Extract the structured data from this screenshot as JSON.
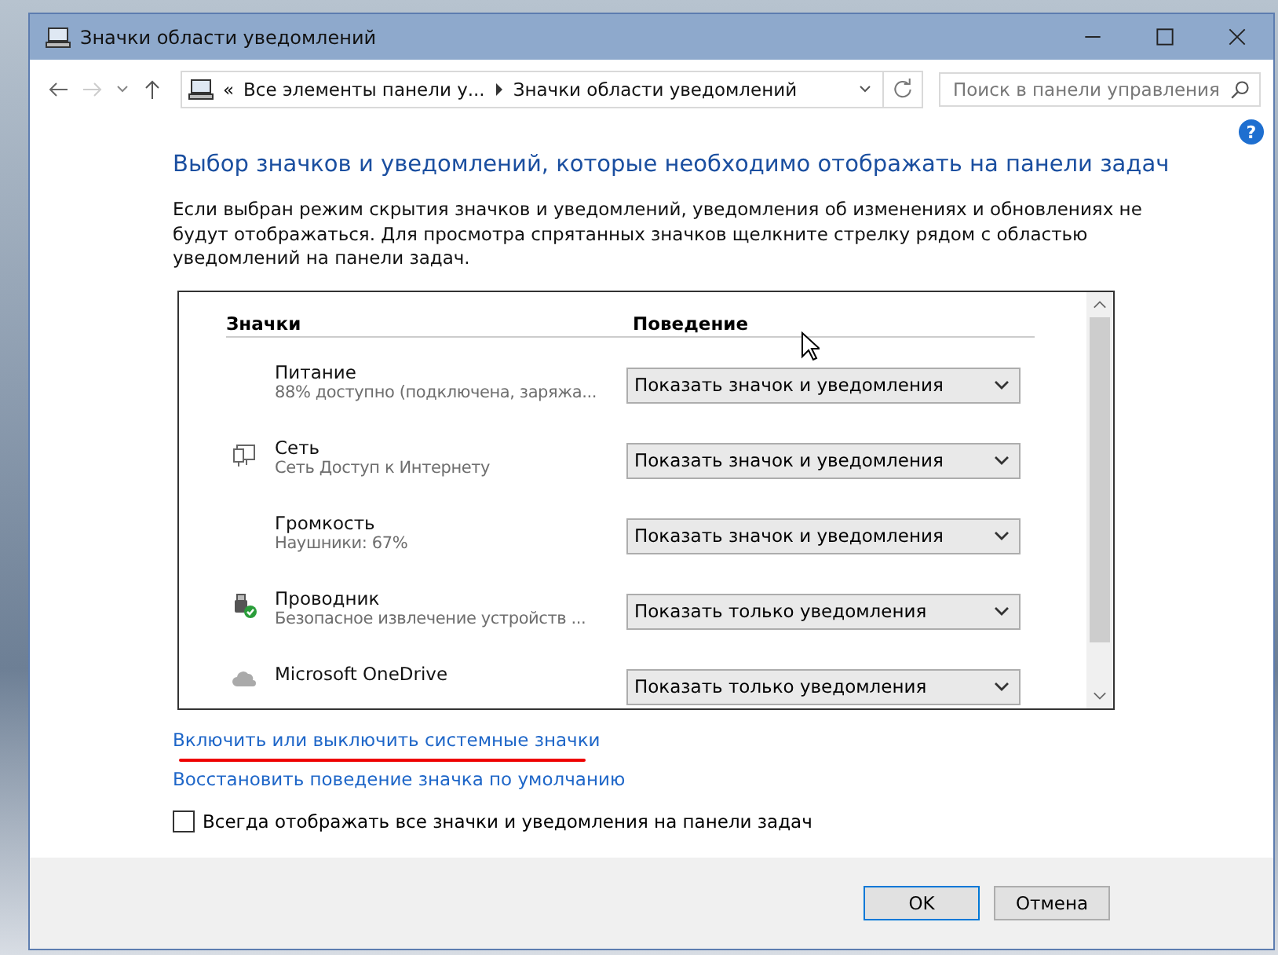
{
  "window": {
    "title": "Значки области уведомлений"
  },
  "address_bar": {
    "overflow": "«",
    "crumbs": [
      "Все элементы панели у...",
      "Значки области уведомлений"
    ]
  },
  "search": {
    "placeholder": "Поиск в панели управления"
  },
  "help": "?",
  "heading": "Выбор значков и уведомлений, которые необходимо отображать на панели задач",
  "description": "Если выбран режим скрытия значков и уведомлений, уведомления об изменениях и обновлениях не будут отображаться. Для просмотра спрятанных значков щелкните стрелку рядом с областью уведомлений на панели задач.",
  "table": {
    "columns": [
      "Значки",
      "Поведение"
    ],
    "rows": [
      {
        "kind": "plain",
        "name": "Питание",
        "detail": "88% доступно (подключена, заряжа...",
        "behavior": "Показать значок и уведомления"
      },
      {
        "kind": "network",
        "name": "Сеть",
        "detail": "Сеть Доступ к Интернету",
        "behavior": "Показать значок и уведомления"
      },
      {
        "kind": "plain",
        "name": "Громкость",
        "detail": "Наушники: 67%",
        "behavior": "Показать значок и уведомления"
      },
      {
        "kind": "drive",
        "name": "Проводник",
        "detail": "Безопасное извлечение устройств ...",
        "behavior": "Показать только уведомления"
      },
      {
        "kind": "cloud",
        "name": "Microsoft OneDrive",
        "behavior": "Показать только уведомления"
      }
    ]
  },
  "links": [
    "Включить или выключить системные значки",
    "Восстановить поведение значка по умолчанию"
  ],
  "always_show": {
    "label": "Всегда отображать все значки и уведомления на панели задач",
    "checked": false
  },
  "buttons": [
    "OK",
    "Отмена"
  ]
}
